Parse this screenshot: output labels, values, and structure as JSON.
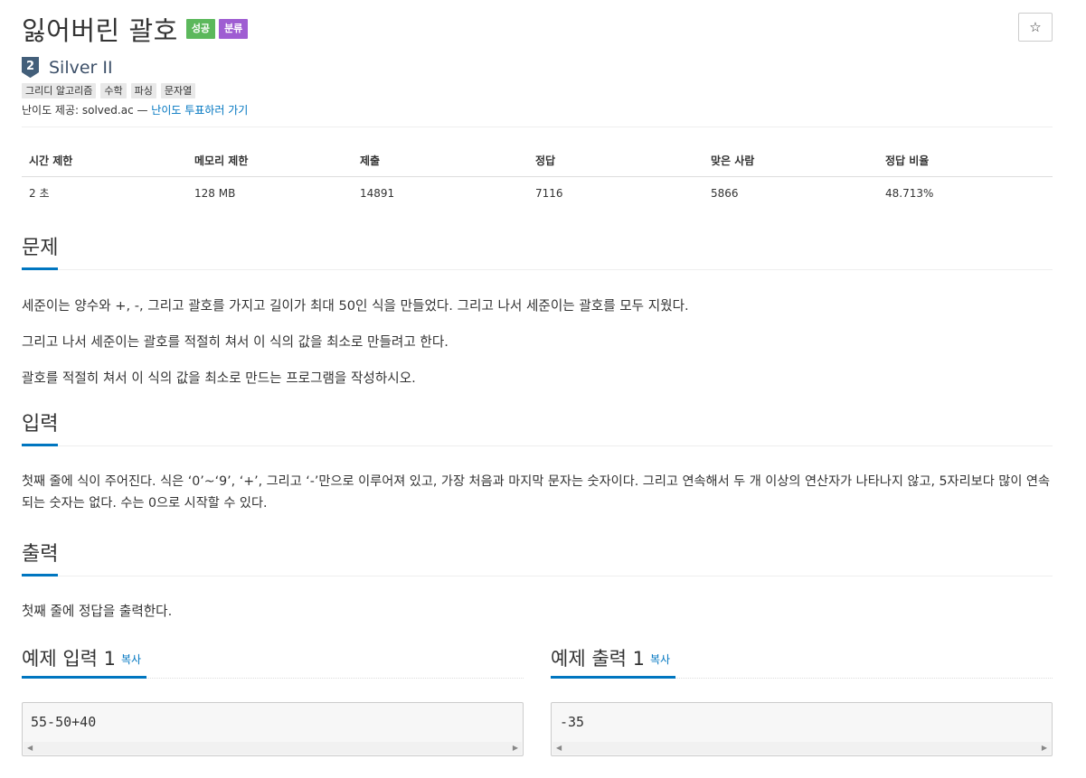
{
  "problem": {
    "title": "잃어버린 괄호",
    "labels": {
      "success": "성공",
      "classify": "분류"
    },
    "star_icon": "☆",
    "tier": {
      "number": "2",
      "name": "Silver II",
      "color": "#435f7a"
    },
    "tags": [
      "그리디 알고리즘",
      "수학",
      "파싱",
      "문자열"
    ],
    "source": {
      "prefix": "난이도 제공: solved.ac — ",
      "link": "난이도 투표하러 가기"
    }
  },
  "info_table": {
    "headers": [
      "시간 제한",
      "메모리 제한",
      "제출",
      "정답",
      "맞은 사람",
      "정답 비율"
    ],
    "values": [
      "2 초",
      "128 MB",
      "14891",
      "7116",
      "5866",
      "48.713%"
    ]
  },
  "sections": {
    "problem": {
      "title": "문제",
      "paragraphs": [
        "세준이는 양수와 +, -, 그리고 괄호를 가지고 길이가 최대 50인 식을 만들었다. 그리고 나서 세준이는 괄호를 모두 지웠다.",
        "그리고 나서 세준이는 괄호를 적절히 쳐서 이 식의 값을 최소로 만들려고 한다.",
        "괄호를 적절히 쳐서 이 식의 값을 최소로 만드는 프로그램을 작성하시오."
      ]
    },
    "input": {
      "title": "입력",
      "paragraph": "첫째 줄에 식이 주어진다. 식은 ‘0’~‘9’, ‘+’, 그리고 ‘-’만으로 이루어져 있고, 가장 처음과 마지막 문자는 숫자이다. 그리고 연속해서 두 개 이상의 연산자가 나타나지 않고, 5자리보다 많이 연속되는 숫자는 없다. 수는 0으로 시작할 수 있다."
    },
    "output": {
      "title": "출력",
      "paragraph": "첫째 줄에 정답을 출력한다."
    }
  },
  "samples": {
    "input": {
      "title": "예제 입력 1",
      "copy": "복사",
      "content": "55-50+40"
    },
    "output": {
      "title": "예제 출력 1",
      "copy": "복사",
      "content": "-35"
    }
  },
  "colors": {
    "accent": "#0076c0",
    "success": "#5cb85c",
    "classify": "#9f5dd2"
  }
}
